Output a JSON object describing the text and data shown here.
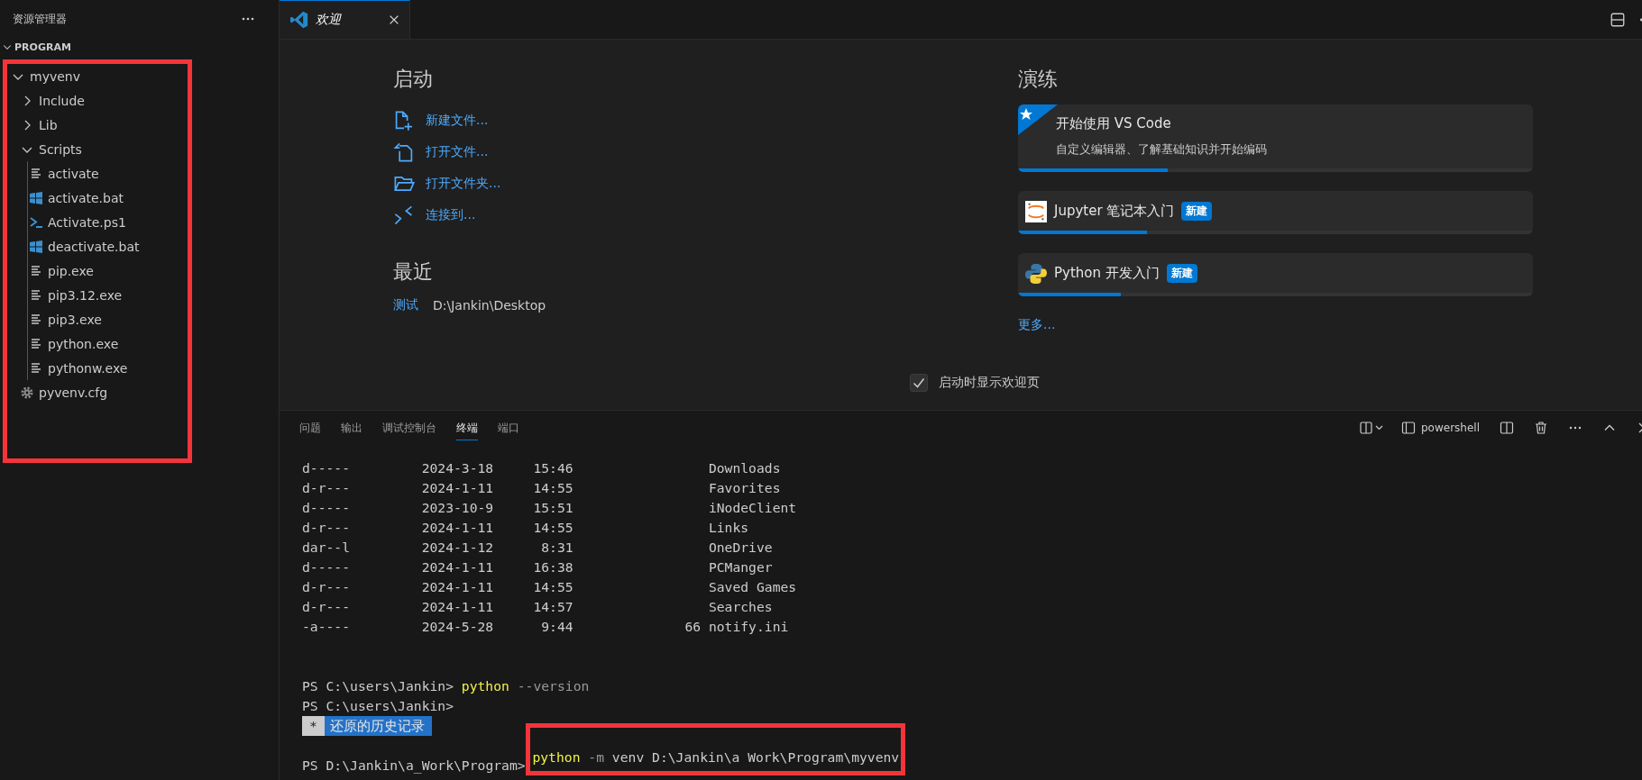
{
  "sidebar": {
    "title": "资源管理器",
    "section": {
      "label": "PROGRAM",
      "expanded": true
    },
    "tree": {
      "highlighted": true,
      "items": [
        {
          "kind": "folder",
          "label": "myvenv",
          "expanded": true,
          "children": [
            {
              "kind": "folder",
              "label": "Include",
              "expanded": false
            },
            {
              "kind": "folder",
              "label": "Lib",
              "expanded": false
            },
            {
              "kind": "folder",
              "label": "Scripts",
              "expanded": true,
              "children": [
                {
                  "kind": "text",
                  "label": "activate"
                },
                {
                  "kind": "batch",
                  "label": "activate.bat"
                },
                {
                  "kind": "powershell",
                  "label": "Activate.ps1"
                },
                {
                  "kind": "batch",
                  "label": "deactivate.bat"
                },
                {
                  "kind": "text",
                  "label": "pip.exe"
                },
                {
                  "kind": "text",
                  "label": "pip3.12.exe"
                },
                {
                  "kind": "text",
                  "label": "pip3.exe"
                },
                {
                  "kind": "text",
                  "label": "python.exe"
                },
                {
                  "kind": "text",
                  "label": "pythonw.exe"
                }
              ]
            },
            {
              "kind": "config",
              "label": "pyvenv.cfg"
            }
          ]
        }
      ]
    }
  },
  "editor_tabs": [
    {
      "label": "欢迎",
      "selected": true,
      "preview": true
    }
  ],
  "welcome": {
    "start": {
      "heading": "启动",
      "actions": [
        {
          "kind": "new-file",
          "label": "新建文件..."
        },
        {
          "kind": "open-file",
          "label": "打开文件..."
        },
        {
          "kind": "open-folder",
          "label": "打开文件夹..."
        },
        {
          "kind": "connect",
          "label": "连接到..."
        }
      ]
    },
    "recent": {
      "heading": "最近",
      "items": [
        {
          "name": "测试",
          "path": "D:\\Jankin\\Desktop"
        }
      ]
    },
    "walkthroughs": {
      "heading": "演练",
      "items": [
        {
          "kind": "featured",
          "title": "开始使用 VS Code",
          "description": "自定义编辑器、了解基础知识并开始编码",
          "level": 0.29
        },
        {
          "kind": "jupyter",
          "title": "Jupyter 笔记本入门",
          "badge": "新建",
          "level": 0.25
        },
        {
          "kind": "python",
          "title": "Python 开发入门",
          "badge": "新建",
          "level": 0.2
        }
      ],
      "more": "更多..."
    },
    "show_on_startup": {
      "label": "启动时显示欢迎页",
      "checked": true
    }
  },
  "panel": {
    "tabs": [
      {
        "label": "问题",
        "selected": false
      },
      {
        "label": "输出",
        "selected": false
      },
      {
        "label": "调试控制台",
        "selected": false
      },
      {
        "label": "终端",
        "selected": true
      },
      {
        "label": "端口",
        "selected": false
      }
    ],
    "terminal_profile": "powershell",
    "terminal_lines": [
      {
        "kind": "entry",
        "mode": "d-----",
        "date": "2024-3-18",
        "time": "15:46",
        "name": "Downloads"
      },
      {
        "kind": "entry",
        "mode": "d-r---",
        "date": "2024-1-11",
        "time": "14:55",
        "name": "Favorites"
      },
      {
        "kind": "entry",
        "mode": "d-----",
        "date": "2023-10-9",
        "time": "15:51",
        "name": "iNodeClient"
      },
      {
        "kind": "entry",
        "mode": "d-r---",
        "date": "2024-1-11",
        "time": "14:55",
        "name": "Links"
      },
      {
        "kind": "entry",
        "mode": "dar--l",
        "date": "2024-1-12",
        "time": "8:31",
        "name": "OneDrive"
      },
      {
        "kind": "entry",
        "mode": "d-----",
        "date": "2024-1-11",
        "time": "16:38",
        "name": "PCManger"
      },
      {
        "kind": "entry",
        "mode": "d-r---",
        "date": "2024-1-11",
        "time": "14:55",
        "name": "Saved Games"
      },
      {
        "kind": "entry",
        "mode": "d-r---",
        "date": "2024-1-11",
        "time": "14:57",
        "name": "Searches"
      },
      {
        "kind": "entry",
        "mode": "-a----",
        "date": "2024-5-28",
        "time": "9:44",
        "length": "66",
        "name": "notify.ini"
      },
      {
        "kind": "blank"
      },
      {
        "kind": "blank"
      },
      {
        "kind": "prompt",
        "prompt": "PS C:\\users\\Jankin>",
        "command": "python",
        "args": [
          {
            "kind": "param",
            "text": "--version"
          }
        ]
      },
      {
        "kind": "prompt",
        "prompt": "PS C:\\users\\Jankin>"
      },
      {
        "kind": "notice",
        "marker": "*",
        "text": "还原的历史记录"
      },
      {
        "kind": "blank"
      },
      {
        "kind": "prompt",
        "prompt": "PS D:\\Jankin\\a_Work\\Program>",
        "command": "python",
        "args": [
          {
            "kind": "param",
            "text": "-m"
          },
          {
            "kind": "arg",
            "text": "venv D:\\Jankin\\a Work\\Program\\myvenv"
          }
        ],
        "highlighted": true
      }
    ]
  }
}
